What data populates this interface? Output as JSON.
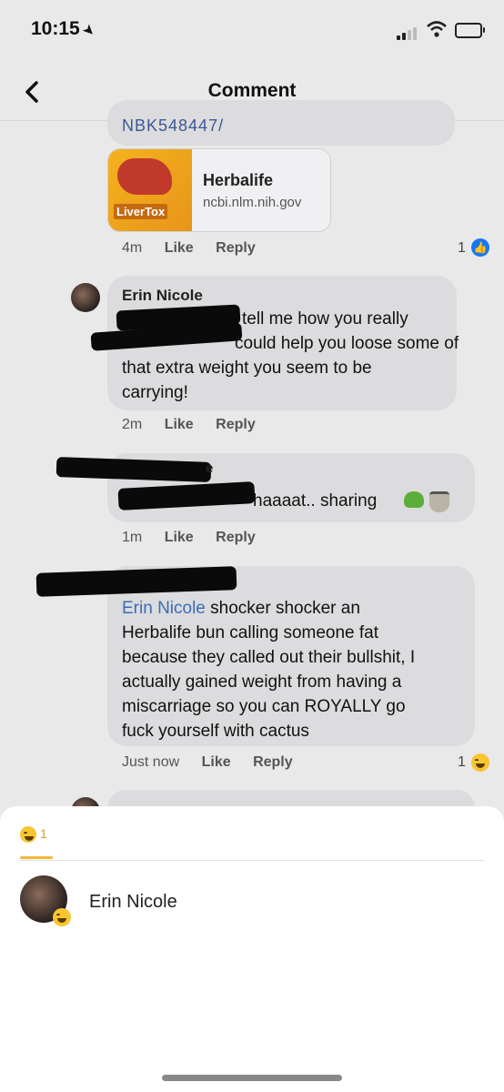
{
  "status_bar": {
    "time": "10:15"
  },
  "header": {
    "title": "Comment"
  },
  "comment1": {
    "truncated_text": "NBK548447/",
    "link": {
      "image_label": "LiverTox",
      "title": "Herbalife",
      "domain": "ncbi.nlm.nih.gov"
    },
    "time": "4m",
    "like": "Like",
    "reply": "Reply",
    "reaction_count": "1"
  },
  "comment2": {
    "author": "Erin Nicole",
    "text_line1": "tell me how you really",
    "text_line2": "could help you loose some of",
    "text_line3": "that extra weight you seem to be",
    "text_line4": "carrying!",
    "time": "2m",
    "like": "Like",
    "reply": "Reply"
  },
  "comment3": {
    "author_fragment": "e",
    "text": "haaaat.. sharing",
    "time": "1m",
    "like": "Like",
    "reply": "Reply"
  },
  "comment4": {
    "mention": "Erin Nicole",
    "text_line1": " shocker shocker an",
    "text_line2": "Herbalife bun calling someone fat",
    "text_line3": "because they called out their bullshit, I",
    "text_line4": "actually gained weight from having a",
    "text_line5": "miscarriage so you can ROYALLY go",
    "text_line6": "fuck yourself with cactus",
    "time": "Just now",
    "like": "Like",
    "reply": "Reply",
    "reaction_count": "1"
  },
  "reactions_sheet": {
    "tab_count": "1",
    "users": [
      {
        "name": "Erin Nicole"
      }
    ]
  }
}
